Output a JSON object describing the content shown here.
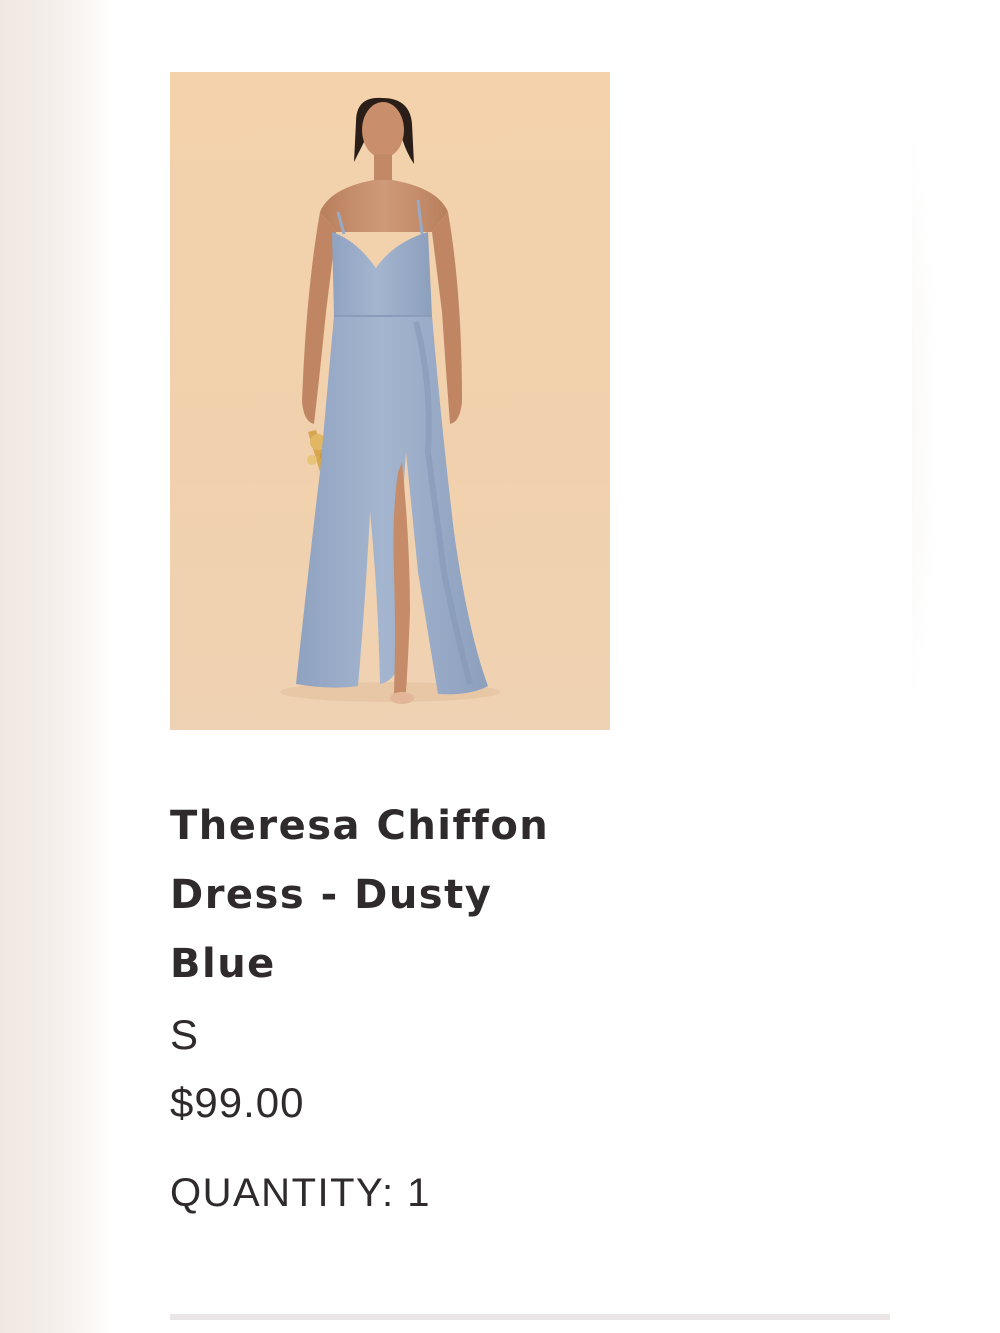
{
  "product": {
    "title": "Theresa Chiffon Dress - Dusty Blue",
    "size": "S",
    "price": "$99.00",
    "quantity_text": "QUANTITY: 1"
  },
  "colors": {
    "image_background": "#f1d1ad",
    "dress": "#9fb1cd",
    "text": "#2f2a2c"
  }
}
